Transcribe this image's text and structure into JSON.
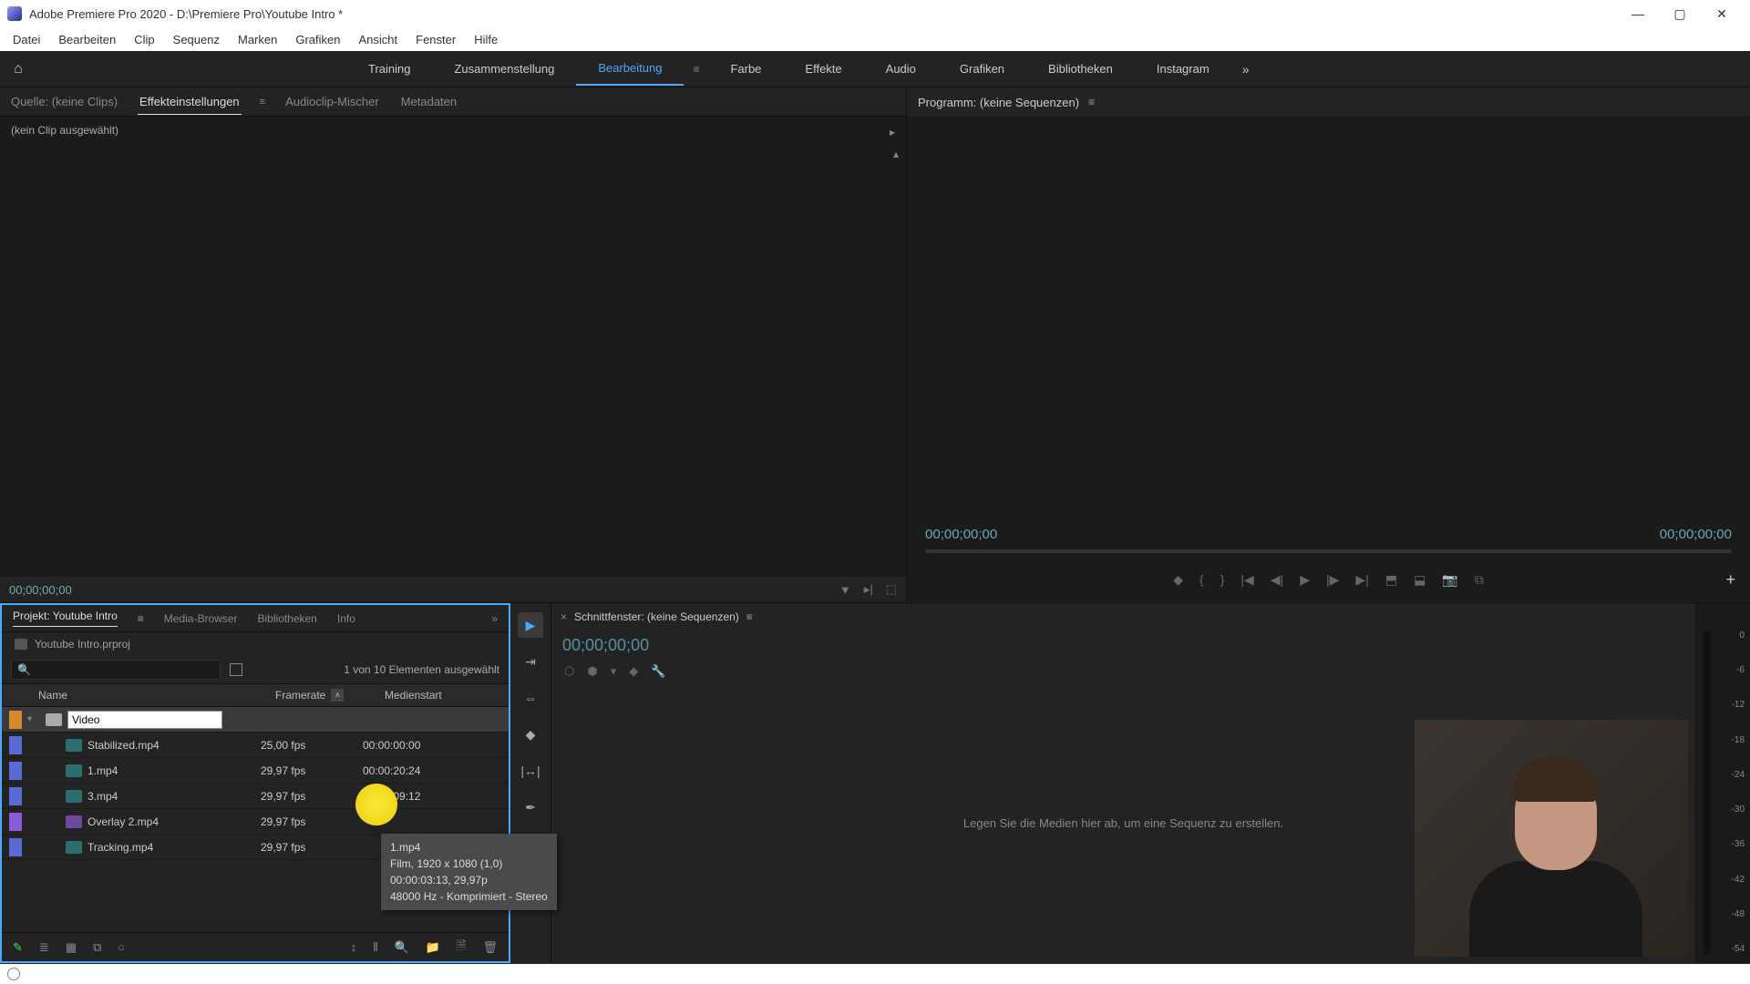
{
  "titlebar": {
    "text": "Adobe Premiere Pro 2020 - D:\\Premiere Pro\\Youtube Intro *"
  },
  "menu": {
    "items": [
      "Datei",
      "Bearbeiten",
      "Clip",
      "Sequenz",
      "Marken",
      "Grafiken",
      "Ansicht",
      "Fenster",
      "Hilfe"
    ]
  },
  "workspaces": {
    "items": [
      "Training",
      "Zusammenstellung",
      "Bearbeitung",
      "Farbe",
      "Effekte",
      "Audio",
      "Grafiken",
      "Bibliotheken",
      "Instagram"
    ],
    "active": "Bearbeitung"
  },
  "source_tabs": {
    "items": [
      "Quelle: (keine Clips)",
      "Effekteinstellungen",
      "Audioclip-Mischer",
      "Metadaten"
    ],
    "active": "Effekteinstellungen"
  },
  "source_panel": {
    "no_clip": "(kein Clip ausgewählt)",
    "tc": "00;00;00;00"
  },
  "program": {
    "label": "Programm: (keine Sequenzen)",
    "tc_left": "00;00;00;00",
    "tc_right": "00;00;00;00"
  },
  "project": {
    "tabs": [
      "Projekt: Youtube Intro",
      "Media-Browser",
      "Bibliotheken",
      "Info"
    ],
    "active": "Projekt: Youtube Intro",
    "filename": "Youtube Intro.prproj",
    "selection": "1 von 10 Elementen ausgewählt",
    "columns": {
      "name": "Name",
      "fps": "Framerate",
      "start": "Medienstart"
    },
    "bin_input": "Video",
    "rows": [
      {
        "tag": "orange",
        "bin": true
      },
      {
        "tag": "blue",
        "type": "video",
        "name": "Stabilized.mp4",
        "fps": "25,00 fps",
        "start": "00:00:00:00"
      },
      {
        "tag": "blue",
        "type": "video",
        "name": "1.mp4",
        "fps": "29,97 fps",
        "start": "00:00:20:24"
      },
      {
        "tag": "blue",
        "type": "video",
        "name": "3.mp4",
        "fps": "29,97 fps",
        "start": "00:00:09:12"
      },
      {
        "tag": "violet",
        "type": "overlay",
        "name": "Overlay 2.mp4",
        "fps": "29,97 fps",
        "start": ""
      },
      {
        "tag": "blue",
        "type": "video",
        "name": "Tracking.mp4",
        "fps": "29,97 fps",
        "start": ""
      }
    ]
  },
  "tooltip": {
    "l1": "1.mp4",
    "l2": "Film, 1920 x 1080 (1,0)",
    "l3": "00:00:03:13, 29,97p",
    "l4": "48000 Hz - Komprimiert - Stereo"
  },
  "timeline": {
    "label": "Schnittfenster: (keine Sequenzen)",
    "tc": "00;00;00;00",
    "drop_hint": "Legen Sie die Medien hier ab, um eine Sequenz zu erstellen."
  },
  "meter": {
    "ticks": [
      "0",
      "-6",
      "-12",
      "-18",
      "-24",
      "-30",
      "-36",
      "-42",
      "-48",
      "-54"
    ]
  }
}
